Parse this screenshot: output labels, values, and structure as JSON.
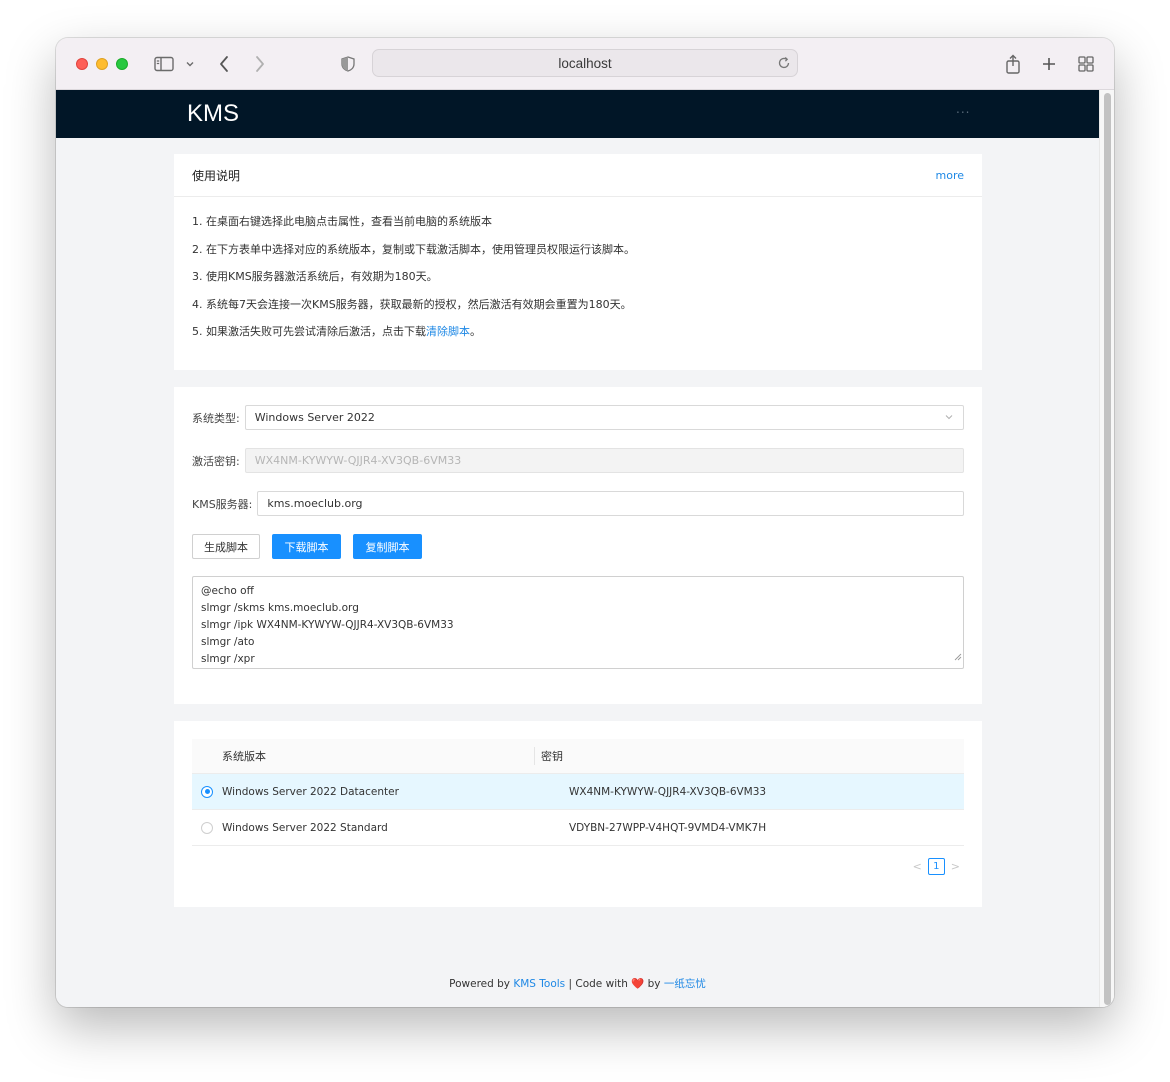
{
  "browser": {
    "url": "localhost"
  },
  "navbar": {
    "logo": "KMS",
    "more": "..."
  },
  "instructions": {
    "title": "使用说明",
    "more_link": "more",
    "steps": [
      "1. 在桌面右键选择此电脑点击属性，查看当前电脑的系统版本",
      "2. 在下方表单中选择对应的系统版本，复制或下载激活脚本，使用管理员权限运行该脚本。",
      "3. 使用KMS服务器激活系统后，有效期为180天。",
      "4. 系统每7天会连接一次KMS服务器，获取最新的授权，然后激活有效期会重置为180天。"
    ],
    "step5_prefix": "5. 如果激活失败可先尝试清除后激活，点击下载",
    "step5_link": "清除脚本",
    "step5_suffix": "。"
  },
  "form": {
    "system_type_label": "系统类型:",
    "system_type_value": "Windows Server 2022",
    "key_label": "激活密钥:",
    "key_value": "WX4NM-KYWYW-QJJR4-XV3QB-6VM33",
    "kms_label": "KMS服务器:",
    "kms_value": "kms.moeclub.org",
    "generate_button": "生成脚本",
    "download_button": "下载脚本",
    "copy_button": "复制脚本",
    "script_lines": [
      "@echo off",
      "slmgr /skms kms.moeclub.org",
      "slmgr /ipk WX4NM-KYWYW-QJJR4-XV3QB-6VM33",
      "slmgr /ato",
      "slmgr /xpr"
    ]
  },
  "table": {
    "col_version": "系统版本",
    "col_key": "密钥",
    "rows": [
      {
        "version": "Windows Server 2022 Datacenter",
        "key": "WX4NM-KYWYW-QJJR4-XV3QB-6VM33",
        "selected": true
      },
      {
        "version": "Windows Server 2022 Standard",
        "key": "VDYBN-27WPP-V4HQT-9VMD4-VMK7H",
        "selected": false
      }
    ],
    "pager": {
      "prev": "<",
      "current": "1",
      "next": ">"
    }
  },
  "footer": {
    "powered_by": "Powered by ",
    "kms_tools": "KMS Tools",
    "separator": " | Code with ",
    "by": " by ",
    "author": "一纸忘忧"
  },
  "colors": {
    "navbar_bg": "#011627",
    "primary": "#1890ff",
    "link": "#1e88e5",
    "selected_row": "#e6f7ff"
  }
}
